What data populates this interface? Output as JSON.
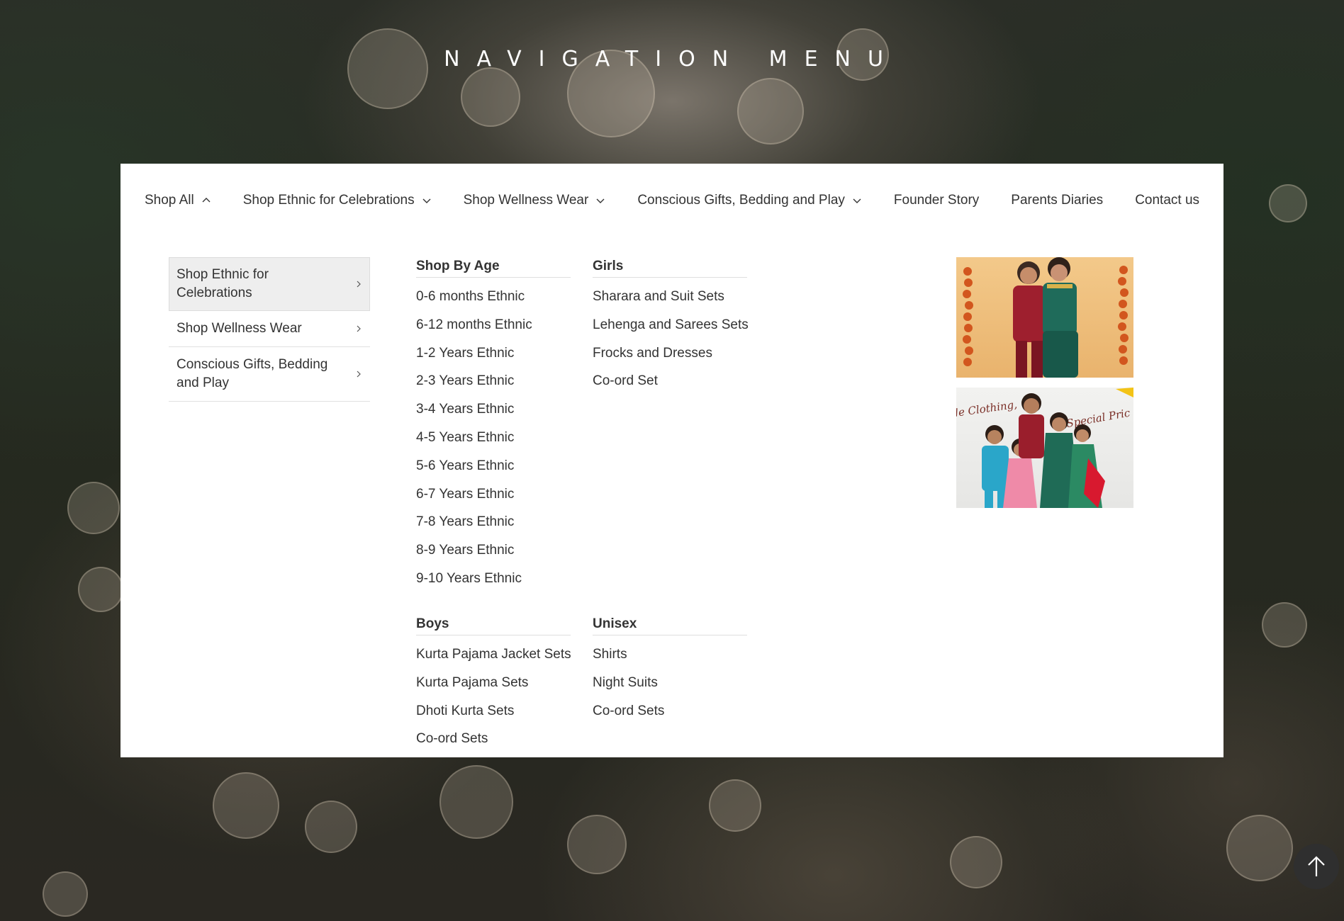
{
  "page": {
    "title": "NAVIGATION MENU"
  },
  "topnav": {
    "items": [
      {
        "label": "Shop All",
        "chevron": "up"
      },
      {
        "label": "Shop Ethnic for Celebrations",
        "chevron": "down"
      },
      {
        "label": "Shop Wellness Wear",
        "chevron": "down"
      },
      {
        "label": "Conscious Gifts, Bedding and Play",
        "chevron": "down"
      },
      {
        "label": "Founder Story"
      },
      {
        "label": "Parents Diaries"
      },
      {
        "label": "Contact us"
      }
    ]
  },
  "submenu": {
    "items": [
      {
        "label": "Shop Ethnic for Celebrations",
        "active": true
      },
      {
        "label": "Shop Wellness Wear"
      },
      {
        "label": "Conscious Gifts, Bedding and Play"
      }
    ]
  },
  "columns": {
    "shop_by_age": {
      "title": "Shop By Age",
      "links": [
        "0-6 months Ethnic",
        "6-12 months Ethnic",
        "1-2 Years Ethnic",
        "2-3 Years Ethnic",
        "3-4 Years Ethnic",
        "4-5 Years Ethnic",
        "5-6 Years Ethnic",
        "6-7 Years Ethnic",
        "7-8 Years Ethnic",
        "8-9 Years Ethnic",
        "9-10 Years Ethnic"
      ]
    },
    "girls": {
      "title": "Girls",
      "links": [
        "Sharara and Suit Sets",
        "Lehenga and Sarees Sets",
        "Frocks and Dresses",
        "Co-ord Set"
      ]
    },
    "boys": {
      "title": "Boys",
      "links": [
        "Kurta Pajama Jacket Sets",
        "Kurta Pajama Sets",
        "Dhoti Kurta Sets",
        "Co-ord Sets"
      ]
    },
    "unisex": {
      "title": "Unisex",
      "links": [
        "Shirts",
        "Night Suits",
        "Co-ord Sets"
      ]
    }
  },
  "promos": {
    "banner2": {
      "text_left": "de Clothing,",
      "text_right": "Special Pric"
    }
  },
  "colors": {
    "panel_bg": "#ffffff",
    "text": "#333333",
    "active_bg": "#eeeeee",
    "scroll_button": "#2f2f2f"
  }
}
